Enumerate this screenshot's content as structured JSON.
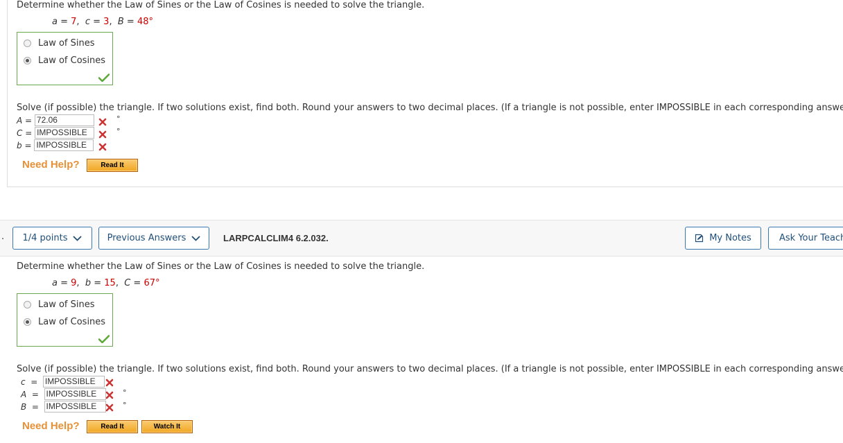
{
  "q1": {
    "prompt": "Determine whether the Law of Sines or the Law of Cosines is needed to solve the triangle.",
    "given": [
      {
        "var": "a",
        "val": "7"
      },
      {
        "var": "c",
        "val": "3"
      },
      {
        "var": "B",
        "val": "48°"
      }
    ],
    "choices": [
      "Law of Sines",
      "Law of Cosines"
    ],
    "selected": "Law of Cosines",
    "solve_prompt": "Solve (if possible) the triangle. If two solutions exist, find both. Round your answers to two decimal places. (If a triangle is not possible, enter IMPOSSIBLE in each corresponding answer blank.)",
    "answers": [
      {
        "label": "A",
        "value": "72.06",
        "status": "incorrect",
        "degree": "°"
      },
      {
        "label": "C",
        "value": "IMPOSSIBLE",
        "status": "incorrect",
        "degree": "°"
      },
      {
        "label": "b",
        "value": "IMPOSSIBLE",
        "status": "incorrect",
        "degree": ""
      }
    ],
    "need_help": "Need Help?",
    "buttons": [
      "Read It"
    ]
  },
  "q2_header": {
    "points": "1/4 points",
    "previous_answers": "Previous Answers",
    "question_id": "LARPCALCLIM4 6.2.032.",
    "my_notes": "My Notes",
    "ask_teacher": "Ask Your Teach"
  },
  "q2": {
    "prompt": "Determine whether the Law of Sines or the Law of Cosines is needed to solve the triangle.",
    "given": [
      {
        "var": "a",
        "val": "9"
      },
      {
        "var": "b",
        "val": "15"
      },
      {
        "var": "C",
        "val": "67°"
      }
    ],
    "choices": [
      "Law of Sines",
      "Law of Cosines"
    ],
    "selected": "Law of Cosines",
    "solve_prompt": "Solve (if possible) the triangle. If two solutions exist, find both. Round your answers to two decimal places. (If a triangle is not possible, enter IMPOSSIBLE in each corresponding answer blank.)",
    "answers": [
      {
        "label": "c",
        "value": "IMPOSSIBLE",
        "status": "incorrect",
        "degree": ""
      },
      {
        "label": "A",
        "value": "IMPOSSIBLE",
        "status": "incorrect",
        "degree": "°"
      },
      {
        "label": "B",
        "value": "IMPOSSIBLE",
        "status": "incorrect",
        "degree": "°"
      }
    ],
    "need_help": "Need Help?",
    "buttons": [
      "Read It",
      "Watch It"
    ]
  },
  "colors": {
    "correct": "#6aa84f",
    "incorrect": "#cc3333",
    "given_value": "#cc0000",
    "help": "#e69138",
    "link": "#1f4e79"
  }
}
